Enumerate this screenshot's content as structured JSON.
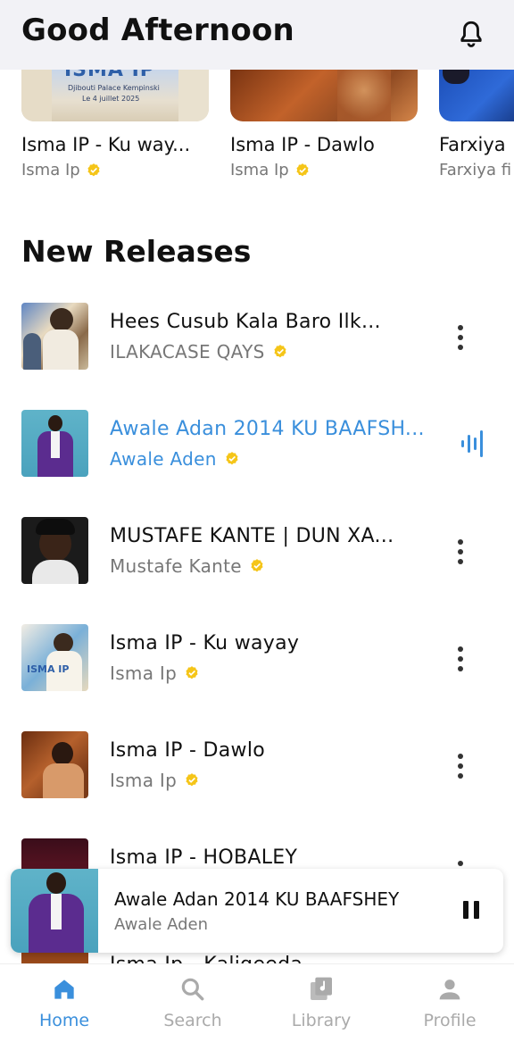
{
  "header": {
    "greeting": "Good Afternoon",
    "icon": "bell-icon"
  },
  "carousel": [
    {
      "title": "Isma IP - Ku way...",
      "artist": "Isma Ip",
      "poster_line1": "Djibouti Palace Kempinski",
      "poster_line2": "Le 4 juillet 2025",
      "poster_brand": "ISMA IP"
    },
    {
      "title": "Isma IP - Dawlo",
      "artist": "Isma Ip"
    },
    {
      "title": "Farxiya",
      "artist": "Farxiya fi"
    }
  ],
  "section": {
    "title": "New Releases"
  },
  "releases": [
    {
      "title": "Hees Cusub Kala Baro Ilk...",
      "artist": "ILAKACASE QAYS",
      "active": false
    },
    {
      "title": "Awale Adan 2014 KU BAAFSH...",
      "artist": "Awale Aden",
      "active": true
    },
    {
      "title": "MUSTAFE KANTE | DUN XA...",
      "artist": "Mustafe Kante",
      "active": false
    },
    {
      "title": "Isma IP - Ku wayay",
      "artist": "Isma Ip",
      "active": false,
      "thumb_text": "ISMA IP"
    },
    {
      "title": "Isma IP - Dawlo",
      "artist": "Isma Ip",
      "active": false
    },
    {
      "title": "Isma IP - HOBALEY",
      "artist": "",
      "active": false
    },
    {
      "title": "Isma Ip - Kaligeeda",
      "artist": "",
      "active": false
    }
  ],
  "now_playing": {
    "title": "Awale Adan 2014 KU BAAFSHEY",
    "artist": "Awale Aden",
    "state": "playing"
  },
  "nav": [
    {
      "label": "Home",
      "icon": "home-icon",
      "active": true
    },
    {
      "label": "Search",
      "icon": "search-icon",
      "active": false
    },
    {
      "label": "Library",
      "icon": "library-icon",
      "active": false
    },
    {
      "label": "Profile",
      "icon": "profile-icon",
      "active": false
    }
  ],
  "colors": {
    "accent": "#3a8fdc",
    "verified": "#f5c518",
    "header_bg": "#f2f2f6"
  }
}
